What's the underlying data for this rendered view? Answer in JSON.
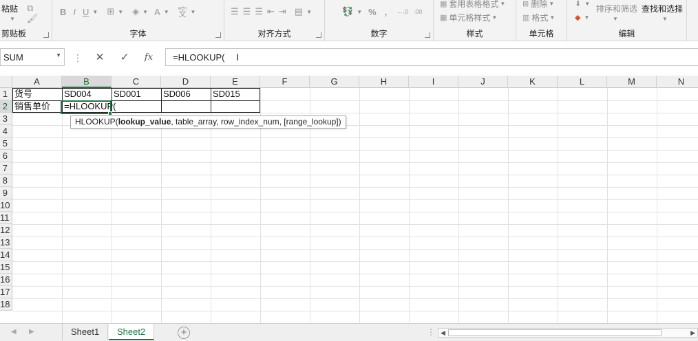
{
  "ribbon": {
    "clipboard": {
      "paste_label": "粘贴",
      "group_label": "剪贴板"
    },
    "font": {
      "group_label": "字体",
      "bold": "B",
      "italic": "I",
      "underline": "U",
      "font_color_glyph": "A",
      "phonetic_top": "wén",
      "phonetic_glyph": "文"
    },
    "alignment": {
      "group_label": "对齐方式"
    },
    "number": {
      "group_label": "数字",
      "percent": "%",
      "comma": ",",
      "inc_decimal": "←.0",
      "dec_decimal": ".00"
    },
    "styles": {
      "group_label": "样式",
      "table_format": "套用表格格式",
      "cell_styles": "单元格样式"
    },
    "cells": {
      "group_label": "单元格",
      "delete": "删除",
      "format": "格式"
    },
    "editing": {
      "group_label": "编辑",
      "sort_filter": "排序和筛选",
      "find_select": "查找和选择"
    }
  },
  "formula_bar": {
    "name_box": "SUM",
    "cancel": "✕",
    "enter": "✓",
    "fx": "fx",
    "formula": "=HLOOKUP("
  },
  "columns": [
    "A",
    "B",
    "C",
    "D",
    "E",
    "F",
    "G",
    "H",
    "I",
    "J",
    "K",
    "L",
    "M",
    "N"
  ],
  "rows": [
    "1",
    "2",
    "3",
    "4",
    "5",
    "6",
    "7",
    "8",
    "9",
    "10",
    "11",
    "12",
    "13",
    "14",
    "15",
    "16",
    "17",
    "18"
  ],
  "cells": {
    "A1": "货号",
    "B1": "SD004",
    "C1": "SD001",
    "D1": "SD006",
    "E1": "SD015",
    "A2": "销售单价",
    "B2": "=HLOOKUP("
  },
  "tooltip": {
    "fn": "HLOOKUP(",
    "arg1": "lookup_value",
    "rest": ", table_array, row_index_num, [range_lookup])"
  },
  "sheets": {
    "tab1": "Sheet1",
    "tab2": "Sheet2",
    "add": "+"
  },
  "colors": {
    "accent": "#217346"
  }
}
